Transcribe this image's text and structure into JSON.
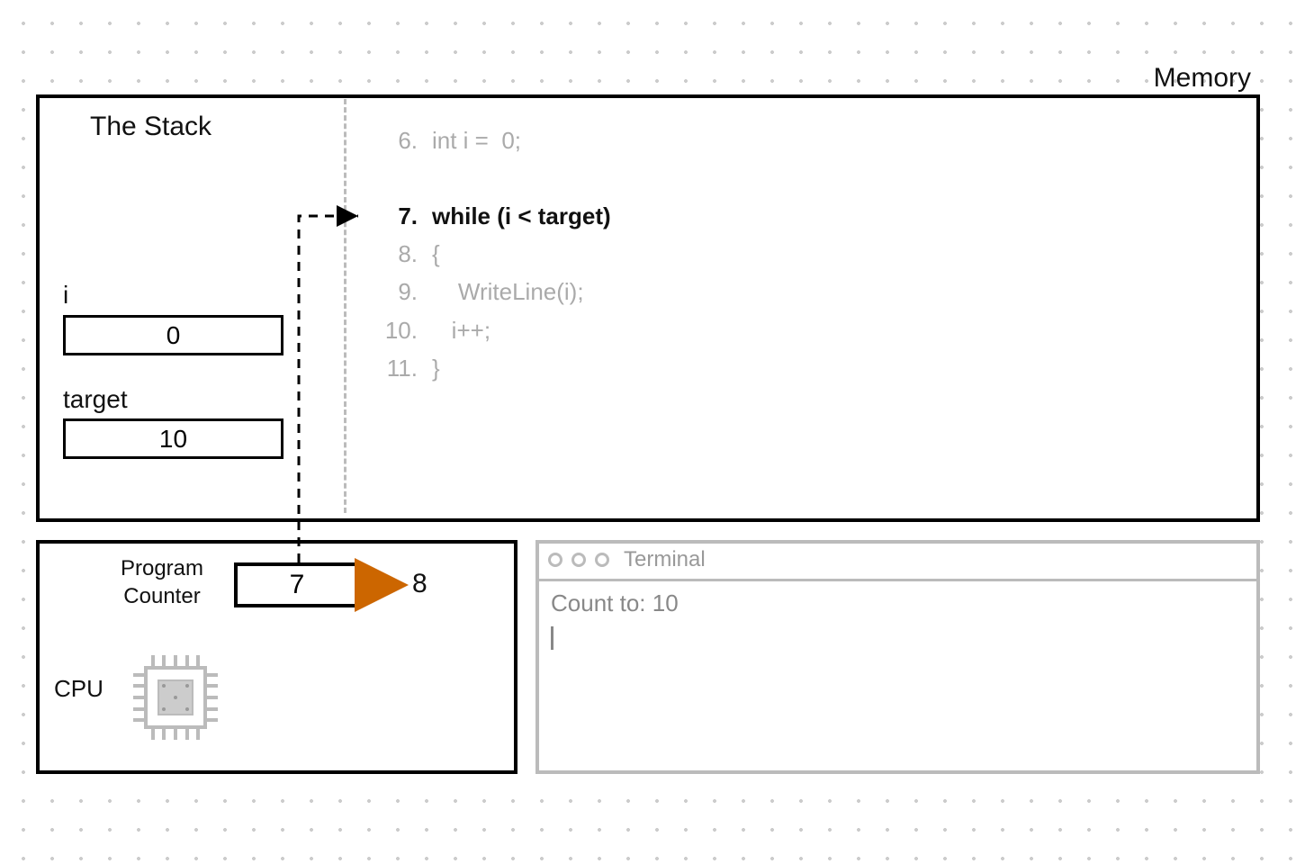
{
  "memory": {
    "title": "Memory",
    "stack_title": "The Stack",
    "vars": {
      "i": {
        "label": "i",
        "value": "0"
      },
      "target": {
        "label": "target",
        "value": "10"
      }
    },
    "code": [
      {
        "n": "6.",
        "text": "int i =  0;",
        "active": false
      },
      {
        "n": "",
        "text": "",
        "active": false
      },
      {
        "n": "7.",
        "text": "while (i < target)",
        "active": true
      },
      {
        "n": "8.",
        "text": "{",
        "active": false
      },
      {
        "n": "9.",
        "text": "    WriteLine(i);",
        "active": false
      },
      {
        "n": "10.",
        "text": "   i++;",
        "active": false
      },
      {
        "n": "11.",
        "text": "}",
        "active": false
      }
    ]
  },
  "cpu": {
    "pc_label_line1": "Program",
    "pc_label_line2": "Counter",
    "pc_value": "7",
    "pc_next": "8",
    "cpu_label": "CPU"
  },
  "terminal": {
    "title": "Terminal",
    "line1_prompt": "Count to: ",
    "line1_value": "10"
  }
}
